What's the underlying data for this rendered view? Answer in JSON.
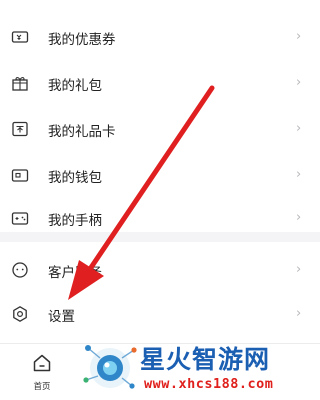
{
  "menu_group_1": [
    {
      "label": "我的优惠券",
      "icon": "coupon-icon"
    },
    {
      "label": "我的礼包",
      "icon": "gift-package-icon"
    },
    {
      "label": "我的礼品卡",
      "icon": "gift-card-icon"
    },
    {
      "label": "我的钱包",
      "icon": "wallet-icon"
    },
    {
      "label": "我的手柄",
      "icon": "gamepad-icon"
    }
  ],
  "menu_group_2": [
    {
      "label": "客户服务",
      "icon": "customer-service-icon"
    },
    {
      "label": "设置",
      "icon": "settings-icon"
    }
  ],
  "chevron": "›",
  "tabbar": {
    "home_label": "首页",
    "home_icon": "home-icon"
  },
  "watermark": {
    "title": "星火智游网",
    "url": "www.xhcs188.com"
  },
  "annotation": {
    "arrow_color": "#e02020",
    "points_to": "设置"
  },
  "colors": {
    "text": "#222222",
    "chevron": "#b8b8bc",
    "separator": "#f4f4f6",
    "watermark_blue": "#1b5fb3",
    "watermark_red": "#e0201c"
  }
}
